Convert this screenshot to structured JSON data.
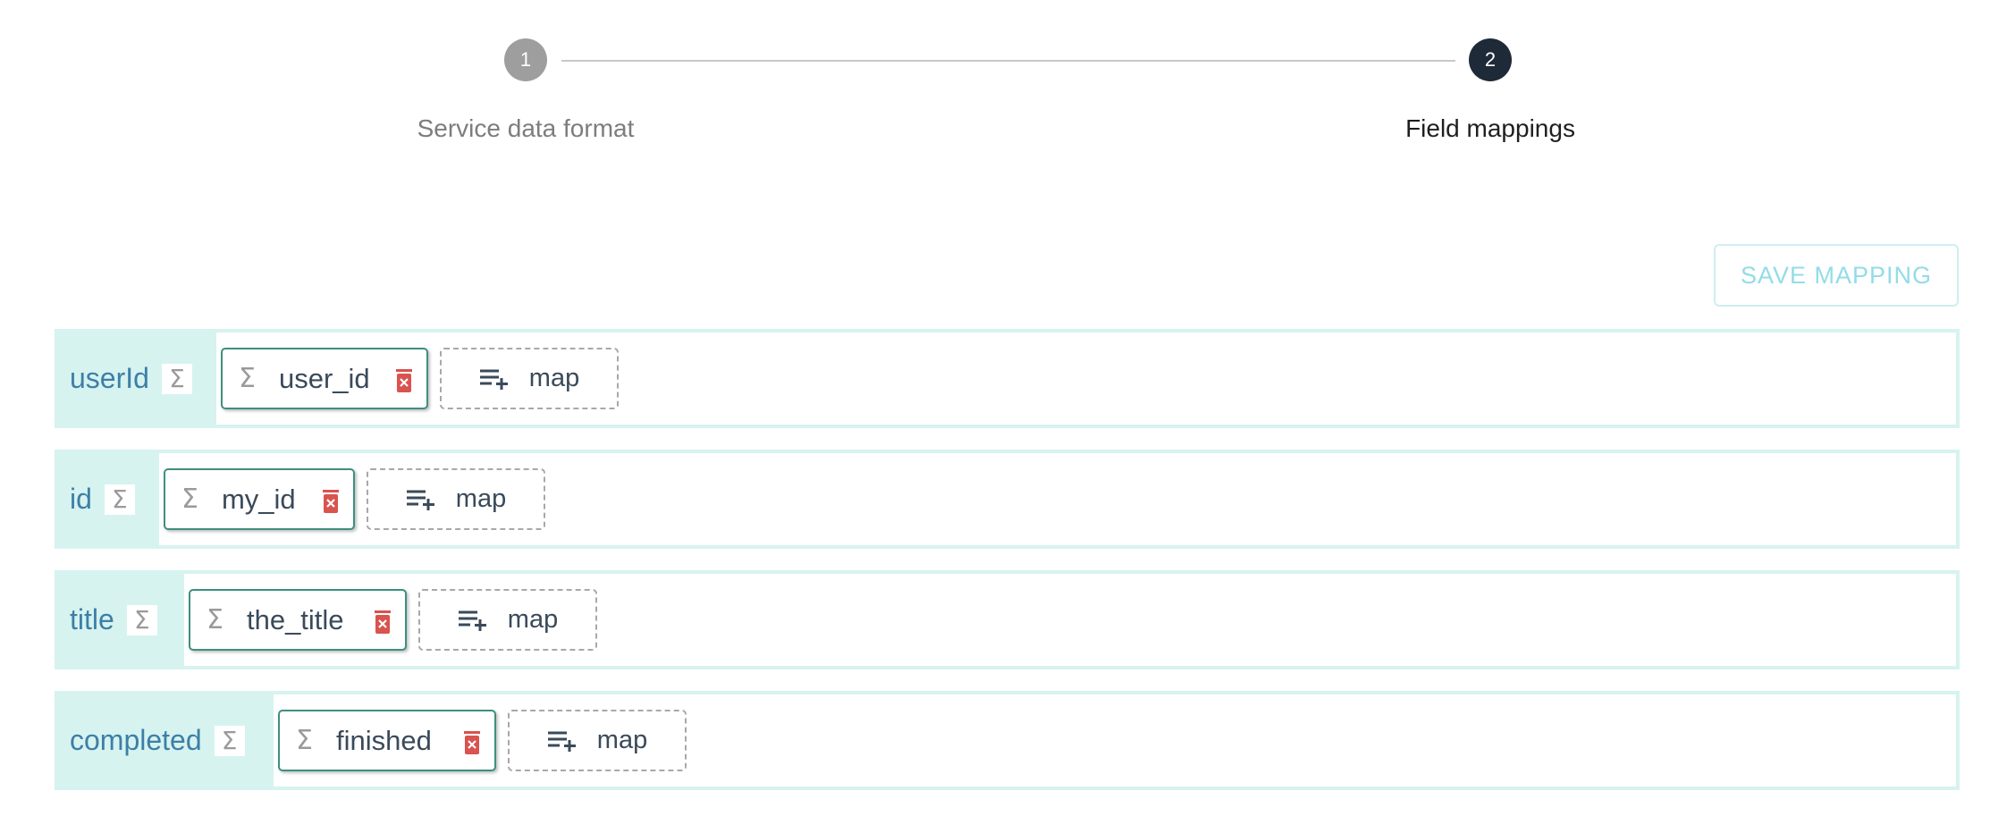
{
  "stepper": {
    "steps": [
      {
        "number": "1",
        "label": "Service data format",
        "state": "completed"
      },
      {
        "number": "2",
        "label": "Field mappings",
        "state": "active"
      }
    ]
  },
  "toolbar": {
    "save_label": "SAVE MAPPING"
  },
  "mappings": [
    {
      "field": "userId",
      "type_icon": "sigma-icon",
      "mapped": "user_id",
      "map_label": "map"
    },
    {
      "field": "id",
      "type_icon": "sigma-icon",
      "mapped": "my_id",
      "map_label": "map"
    },
    {
      "field": "title",
      "type_icon": "sigma-icon",
      "mapped": "the_title",
      "map_label": "map"
    },
    {
      "field": "completed",
      "type_icon": "sigma-icon",
      "mapped": "finished",
      "map_label": "map"
    }
  ],
  "colors": {
    "accent_teal": "#d6f3f0",
    "field_text": "#3d7fa6",
    "delete_red": "#d9534f",
    "active_step": "#1e2a38",
    "inactive_step": "#9e9e9e"
  }
}
